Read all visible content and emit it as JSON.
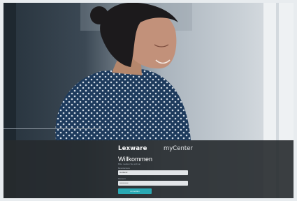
{
  "brand": {
    "logo": "Lexware",
    "app": "myCenter"
  },
  "login": {
    "title": "Willkommen",
    "subtitle": "Bitte melden Sie sich an",
    "username_label": "Benutzername",
    "username_value": "Gottland",
    "password_label": "Passwort",
    "password_value": "••••••••••••",
    "submit_label": "Anmelden"
  },
  "colors": {
    "accent": "#2aa8b3",
    "overlay": "#262a2e"
  }
}
